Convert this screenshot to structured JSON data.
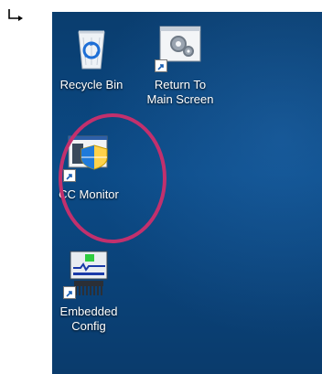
{
  "desktop": {
    "icons": [
      {
        "id": "recycle-bin",
        "label": "Recycle Bin",
        "icon": "recycle-bin-icon"
      },
      {
        "id": "return-to-main-screen",
        "label": "Return To\nMain Screen",
        "icon": "settings-gears-icon"
      },
      {
        "id": "cc-monitor",
        "label": "CC Monitor",
        "icon": "cc-monitor-icon"
      },
      {
        "id": "embedded-config",
        "label": "Embedded\nConfig",
        "icon": "embedded-config-icon"
      }
    ]
  },
  "colors": {
    "desktop_background": "#0b4a86",
    "highlight_ring": "#c2306d",
    "label_text": "#ffffff"
  }
}
